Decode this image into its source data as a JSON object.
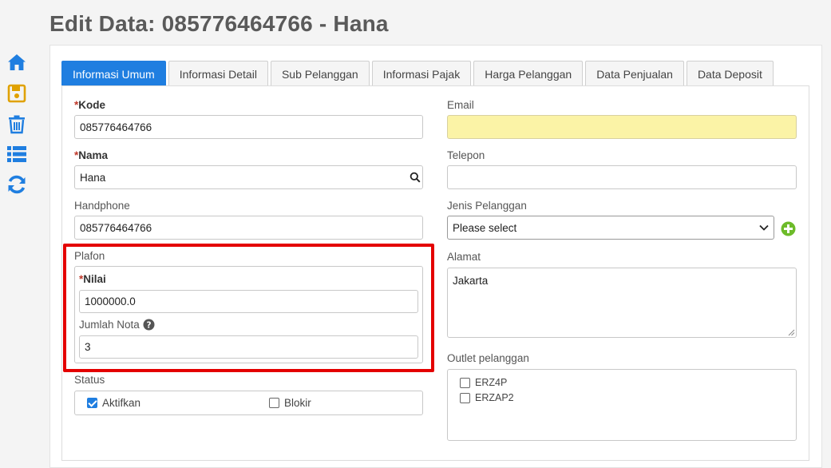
{
  "page": {
    "title": "Edit Data: 085776464766 - Hana"
  },
  "sidebar": {
    "icons": [
      "home-icon",
      "save-icon",
      "trash-icon",
      "list-icon",
      "refresh-icon"
    ],
    "colors": {
      "primary": "#1f7ee0",
      "save": "#e0a100"
    }
  },
  "tabs": [
    {
      "label": "Informasi Umum",
      "active": true
    },
    {
      "label": "Informasi Detail"
    },
    {
      "label": "Sub Pelanggan"
    },
    {
      "label": "Informasi Pajak"
    },
    {
      "label": "Harga Pelanggan"
    },
    {
      "label": "Data Penjualan"
    },
    {
      "label": "Data Deposit"
    }
  ],
  "form": {
    "kode": {
      "required_mark": "*",
      "label": "Kode",
      "value": "085776464766"
    },
    "nama": {
      "required_mark": "*",
      "label": "Nama",
      "value": "Hana"
    },
    "handphone": {
      "label": "Handphone",
      "value": "085776464766"
    },
    "plafon": {
      "label": "Plafon",
      "nilai": {
        "required_mark": "*",
        "label": "Nilai",
        "value": "1000000.0"
      },
      "jumlah_nota": {
        "label": "Jumlah Nota",
        "value": "3"
      }
    },
    "status": {
      "label": "Status",
      "aktifkan": {
        "label": "Aktifkan",
        "checked": true
      },
      "blokir": {
        "label": "Blokir",
        "checked": false
      }
    },
    "email": {
      "label": "Email",
      "value": ""
    },
    "telepon": {
      "label": "Telepon",
      "value": ""
    },
    "jenis_pelanggan": {
      "label": "Jenis Pelanggan",
      "selected": "Please select"
    },
    "alamat": {
      "label": "Alamat",
      "value": "Jakarta"
    },
    "outlet": {
      "label": "Outlet pelanggan",
      "items": [
        {
          "label": "ERZ4P",
          "checked": false
        },
        {
          "label": "ERZAP2",
          "checked": false
        }
      ]
    }
  },
  "colors": {
    "accent": "#1f7ee0",
    "highlight": "#e40000",
    "email_bg": "#fbf3a6",
    "add_button": "#6dbb2a"
  }
}
